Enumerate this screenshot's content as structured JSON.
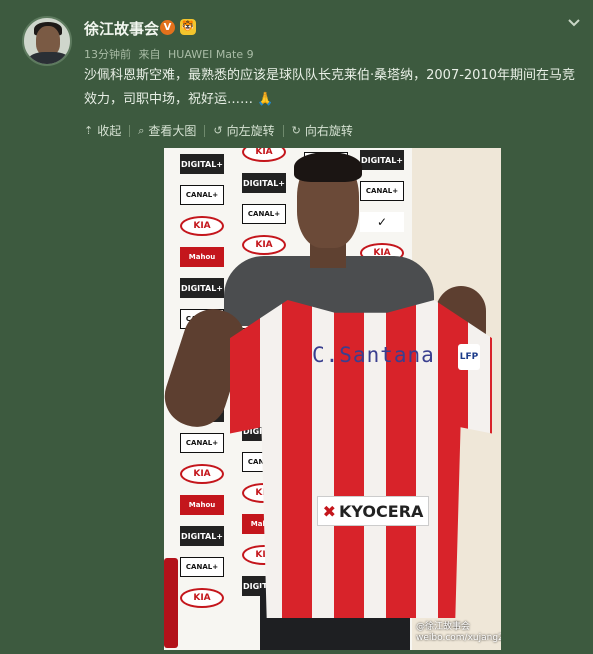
{
  "post": {
    "username": "徐江故事会",
    "verified_badge": "V",
    "level_badge": "🐯",
    "meta": {
      "time": "13分钟前",
      "source_prefix": "来自",
      "device": "HUAWEI Mate 9"
    },
    "text": "沙佩科恩斯空难，最熟悉的应该是球队队长克莱伯·桑塔纳，2007-2010年期间在马竞效力，司职中场，祝好运……",
    "emoji": "🙏"
  },
  "actions": [
    {
      "icon": "collapse-icon",
      "label": "收起"
    },
    {
      "icon": "zoom-icon",
      "label": "查看大图"
    },
    {
      "icon": "rotate-left-icon",
      "label": "向左旋转"
    },
    {
      "icon": "rotate-right-icon",
      "label": "向右旋转"
    }
  ],
  "photo": {
    "jersey_name": "C.Santana",
    "sponsor": "KYOCERA",
    "patch": "LFP",
    "backdrop_logos": [
      "DIGITAL+",
      "CANAL+",
      "KIA",
      "Mahou"
    ],
    "watermark_user": "@徐江故事会",
    "watermark_url": "weibo.com/xujang2010"
  },
  "colors": {
    "background": "#3d5a3f",
    "jersey_red": "#d8232a",
    "jersey_white": "#f4f1ee"
  }
}
